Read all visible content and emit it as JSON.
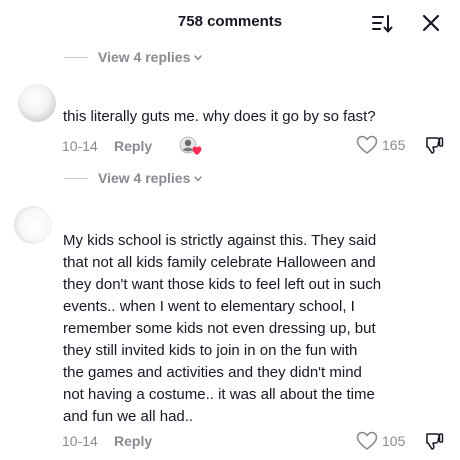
{
  "header": {
    "title": "758 comments"
  },
  "replies_toggle_1": {
    "label": "View 4 replies"
  },
  "comment1": {
    "text": "this literally guts me. why does it go by so fast?",
    "date": "10-14",
    "reply_label": "Reply",
    "likes": "165"
  },
  "replies_toggle_2": {
    "label": "View 4 replies"
  },
  "comment2": {
    "lines": [
      "My kids school is strictly against this. They said",
      "that not all kids family celebrate Halloween and",
      "they don't want those kids to feel left out in such",
      "events.. when I went to elementary school, I",
      "remember some kids not even dressing up, but",
      "they still invited kids to join in on the fun with",
      "the games and activities and they didn't mind",
      "not having a costume.. it was all about the time",
      "and fun we all had.."
    ],
    "date": "10-14",
    "reply_label": "Reply",
    "likes": "105"
  }
}
